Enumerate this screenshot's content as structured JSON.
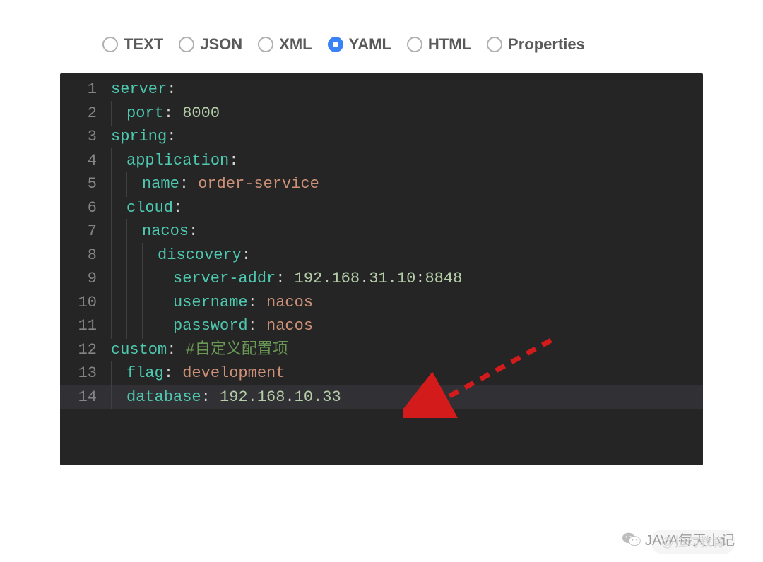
{
  "formats": [
    {
      "label": "TEXT",
      "selected": false
    },
    {
      "label": "JSON",
      "selected": false
    },
    {
      "label": "XML",
      "selected": false
    },
    {
      "label": "YAML",
      "selected": true
    },
    {
      "label": "HTML",
      "selected": false
    },
    {
      "label": "Properties",
      "selected": false
    }
  ],
  "code_lines": [
    {
      "num": "1",
      "indent": 0,
      "tokens": [
        {
          "cls": "key-teal",
          "text": "server"
        },
        {
          "cls": "plain",
          "text": ":"
        }
      ]
    },
    {
      "num": "2",
      "indent": 1,
      "tokens": [
        {
          "cls": "key-teal",
          "text": "port"
        },
        {
          "cls": "plain",
          "text": ": "
        },
        {
          "cls": "number",
          "text": "8000"
        }
      ]
    },
    {
      "num": "3",
      "indent": 0,
      "tokens": [
        {
          "cls": "key-teal",
          "text": "spring"
        },
        {
          "cls": "plain",
          "text": ":"
        }
      ]
    },
    {
      "num": "4",
      "indent": 1,
      "tokens": [
        {
          "cls": "key-teal",
          "text": "application"
        },
        {
          "cls": "plain",
          "text": ":"
        }
      ]
    },
    {
      "num": "5",
      "indent": 2,
      "tokens": [
        {
          "cls": "key-teal",
          "text": "name"
        },
        {
          "cls": "plain",
          "text": ": "
        },
        {
          "cls": "string-orange",
          "text": "order-service"
        }
      ]
    },
    {
      "num": "6",
      "indent": 1,
      "tokens": [
        {
          "cls": "key-teal",
          "text": "cloud"
        },
        {
          "cls": "plain",
          "text": ":"
        }
      ]
    },
    {
      "num": "7",
      "indent": 2,
      "tokens": [
        {
          "cls": "key-teal",
          "text": "nacos"
        },
        {
          "cls": "plain",
          "text": ":"
        }
      ]
    },
    {
      "num": "8",
      "indent": 3,
      "tokens": [
        {
          "cls": "key-teal",
          "text": "discovery"
        },
        {
          "cls": "plain",
          "text": ":"
        }
      ]
    },
    {
      "num": "9",
      "indent": 4,
      "tokens": [
        {
          "cls": "key-teal",
          "text": "server-addr"
        },
        {
          "cls": "plain",
          "text": ": "
        },
        {
          "cls": "number",
          "text": "192.168"
        },
        {
          "cls": "plain",
          "text": "."
        },
        {
          "cls": "number",
          "text": "31.10"
        },
        {
          "cls": "plain",
          "text": ":"
        },
        {
          "cls": "number",
          "text": "8848"
        }
      ]
    },
    {
      "num": "10",
      "indent": 4,
      "tokens": [
        {
          "cls": "key-teal",
          "text": "username"
        },
        {
          "cls": "plain",
          "text": ": "
        },
        {
          "cls": "string-orange",
          "text": "nacos"
        }
      ]
    },
    {
      "num": "11",
      "indent": 4,
      "tokens": [
        {
          "cls": "key-teal",
          "text": "password"
        },
        {
          "cls": "plain",
          "text": ": "
        },
        {
          "cls": "string-orange",
          "text": "nacos"
        }
      ]
    },
    {
      "num": "12",
      "indent": 0,
      "tokens": [
        {
          "cls": "key-teal",
          "text": "custom"
        },
        {
          "cls": "plain",
          "text": ": "
        },
        {
          "cls": "comment",
          "text": "#自定义配置项"
        }
      ]
    },
    {
      "num": "13",
      "indent": 1,
      "tokens": [
        {
          "cls": "key-teal",
          "text": "flag"
        },
        {
          "cls": "plain",
          "text": ": "
        },
        {
          "cls": "string-orange",
          "text": "development"
        }
      ]
    },
    {
      "num": "14",
      "indent": 1,
      "highlighted": true,
      "tokens": [
        {
          "cls": "key-teal",
          "text": "database"
        },
        {
          "cls": "plain",
          "text": ": "
        },
        {
          "cls": "number",
          "text": "192.168"
        },
        {
          "cls": "plain",
          "text": "."
        },
        {
          "cls": "number",
          "text": "10.33"
        }
      ]
    }
  ],
  "watermark": {
    "text": "JAVA每天小记",
    "faded_badge": "@拉勾教育"
  }
}
